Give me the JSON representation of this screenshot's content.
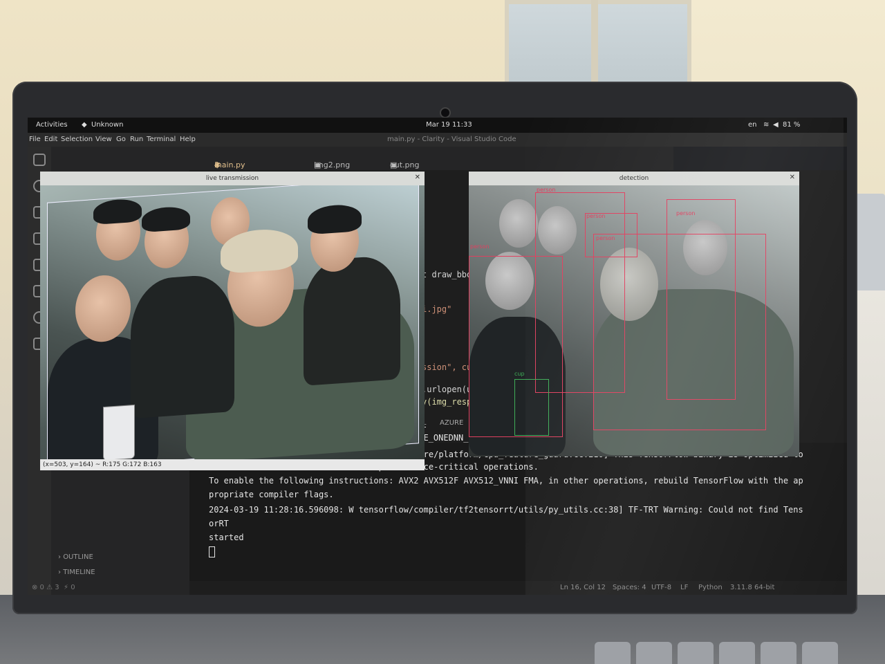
{
  "os_topbar": {
    "activities": "Activities",
    "app_name": "Unknown",
    "clock": "Mar 19  11:33",
    "language": "en",
    "battery": "81 %"
  },
  "menubar": {
    "items": [
      "File",
      "Edit",
      "Selection",
      "View",
      "Go",
      "Run",
      "Terminal",
      "Help"
    ],
    "title": "main.py - Clarity - Visual Studio Code"
  },
  "tabs": [
    {
      "label": "main.py",
      "badge": "3"
    },
    {
      "label": "img2.png"
    },
    {
      "label": "out.png"
    }
  ],
  "live_window": {
    "title": "live transmission",
    "status_text": "(x=503, y=164) ~ R:175 G:172 B:163"
  },
  "detection_window": {
    "title": "detection",
    "labels": [
      "person",
      "person",
      "person",
      "person",
      "person",
      "cup"
    ]
  },
  "editor": {
    "lines": [
      "t draw_bbo",
      "i.jpg\"",
      "ssion\", cu",
      ".urlopen(u",
      "y(img_resp"
    ]
  },
  "panel": {
    "tabs": [
      "AL",
      "AZURE"
    ],
    "env_line": "BLE_ONEDNN_OPTS=0`."
  },
  "terminal": {
    "lines": [
      "2024-03-19 11:28:15.183934: I tensorflow/core/platform/cpu_feature_guard.cc:210] This TensorFlow binary is optimized to",
      " use available CPU instructions in performance-critical operations.",
      "To enable the following instructions: AVX2 AVX512F AVX512_VNNI FMA, in other operations, rebuild TensorFlow with the ap",
      "propriate compiler flags.",
      "2024-03-19 11:28:16.596098: W tensorflow/compiler/tf2tensorrt/utils/py_utils.cc:38] TF-TRT Warning: Could not find Tens",
      "orRT",
      "started"
    ]
  },
  "sidebar": {
    "outline": "OUTLINE",
    "timeline": "TIMELINE",
    "problems": "⊗ 0 ⚠ 3",
    "ports": "⚡ 0"
  },
  "statusbar": {
    "position": "Ln 16, Col 12",
    "spaces": "Spaces: 4",
    "encoding": "UTF-8",
    "eol": "LF",
    "language": "Python",
    "interpreter": "3.11.8 64-bit"
  },
  "colors": {
    "bbox_person": "#e0405f",
    "bbox_cup": "#3fae58",
    "terminal_bg": "#1a1a1a"
  }
}
